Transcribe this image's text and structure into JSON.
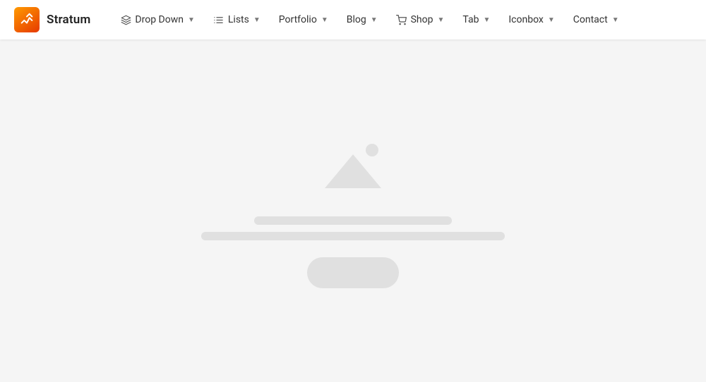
{
  "brand": {
    "name": "Stratum",
    "logo_alt": "Stratum logo"
  },
  "nav": {
    "items": [
      {
        "id": "dropdown",
        "label": "Drop Down",
        "icon": "layers-icon",
        "has_dropdown": true
      },
      {
        "id": "lists",
        "label": "Lists",
        "icon": "list-icon",
        "has_dropdown": true
      },
      {
        "id": "portfolio",
        "label": "Portfolio",
        "icon": null,
        "has_dropdown": true
      },
      {
        "id": "blog",
        "label": "Blog",
        "icon": null,
        "has_dropdown": true
      },
      {
        "id": "shop",
        "label": "Shop",
        "icon": "cart-icon",
        "has_dropdown": true
      },
      {
        "id": "tab",
        "label": "Tab",
        "icon": null,
        "has_dropdown": true
      },
      {
        "id": "iconbox",
        "label": "Iconbox",
        "icon": null,
        "has_dropdown": true
      },
      {
        "id": "contact",
        "label": "Contact",
        "icon": null,
        "has_dropdown": true
      }
    ]
  },
  "main": {
    "placeholder_alt": "image placeholder"
  }
}
